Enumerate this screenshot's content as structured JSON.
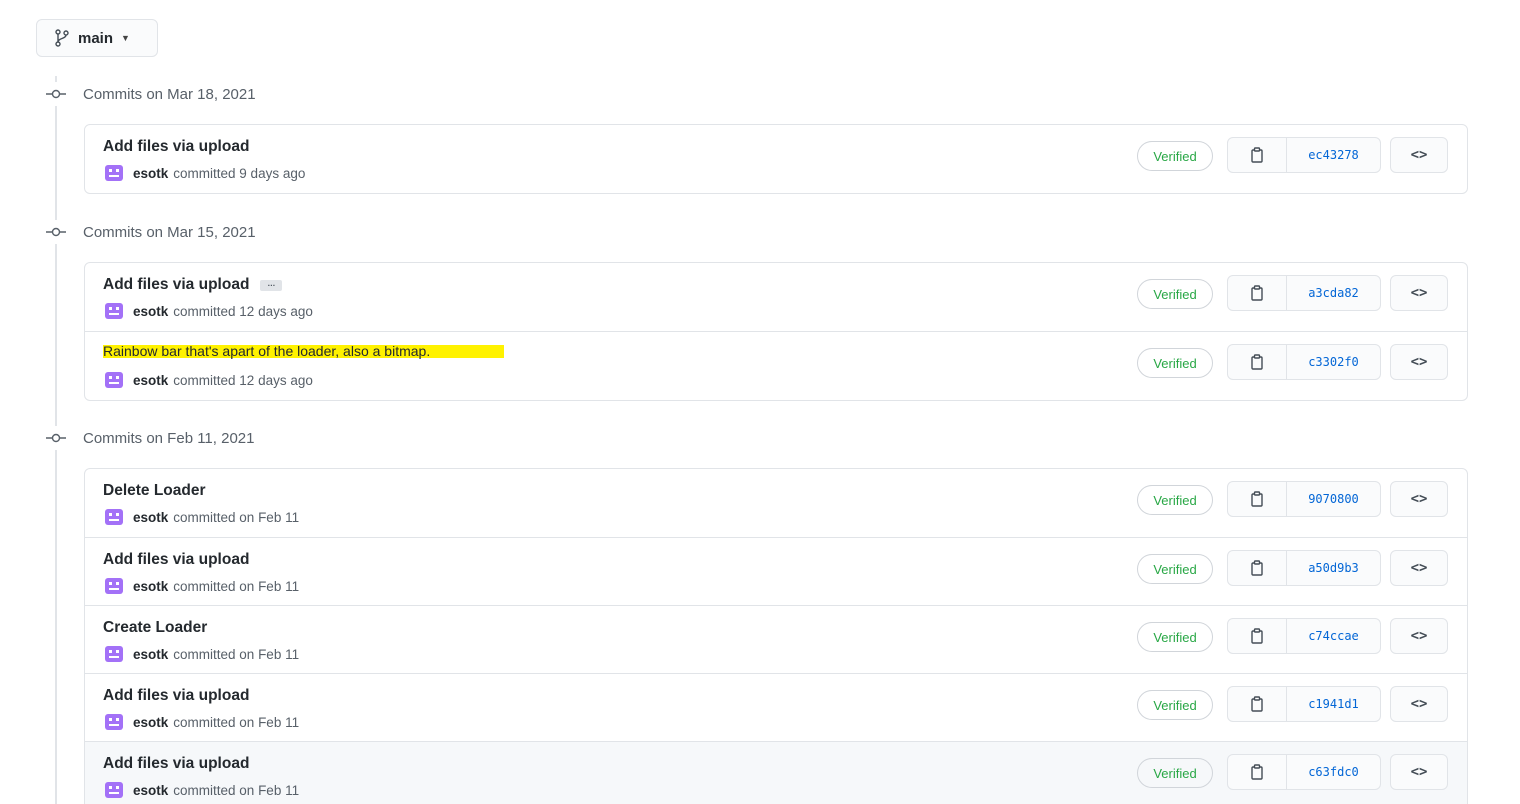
{
  "branch": {
    "name": "main"
  },
  "groups": [
    {
      "date_label": "Commits on Mar 18, 2021",
      "commits": [
        {
          "message": "Add files via upload",
          "author": "esotk",
          "when": "committed 9 days ago",
          "badge": "Verified",
          "sha": "ec43278"
        }
      ]
    },
    {
      "date_label": "Commits on Mar 15, 2021",
      "commits": [
        {
          "message": "Add files via upload",
          "author": "esotk",
          "when": "committed 12 days ago",
          "badge": "Verified",
          "sha": "a3cda82",
          "ellipsis": "…"
        },
        {
          "message": "Rainbow bar that's apart of the loader, also a bitmap.",
          "author": "esotk",
          "when": "committed 12 days ago",
          "badge": "Verified",
          "sha": "c3302f0"
        }
      ]
    },
    {
      "date_label": "Commits on Feb 11, 2021",
      "commits": [
        {
          "message": "Delete Loader",
          "author": "esotk",
          "when": "committed on Feb 11",
          "badge": "Verified",
          "sha": "9070800"
        },
        {
          "message": "Add files via upload",
          "author": "esotk",
          "when": "committed on Feb 11",
          "badge": "Verified",
          "sha": "a50d9b3"
        },
        {
          "message": "Create Loader",
          "author": "esotk",
          "when": "committed on Feb 11",
          "badge": "Verified",
          "sha": "c74ccae"
        },
        {
          "message": "Add files via upload",
          "author": "esotk",
          "when": "committed on Feb 11",
          "badge": "Verified",
          "sha": "c1941d1"
        },
        {
          "message": "Add files via upload",
          "author": "esotk",
          "when": "committed on Feb 11",
          "badge": "Verified",
          "sha": "c63fdc0"
        }
      ]
    }
  ],
  "icons": {
    "branch": "git-branch-icon",
    "commit_dot": "git-commit-icon",
    "avatar": "identicon-avatar",
    "copy": "clipboard-icon",
    "browse": "code-icon"
  },
  "colors": {
    "verified": "#28a745",
    "sha_link": "#0366d6",
    "avatar": "#a371f7",
    "highlight": "#fff200"
  }
}
